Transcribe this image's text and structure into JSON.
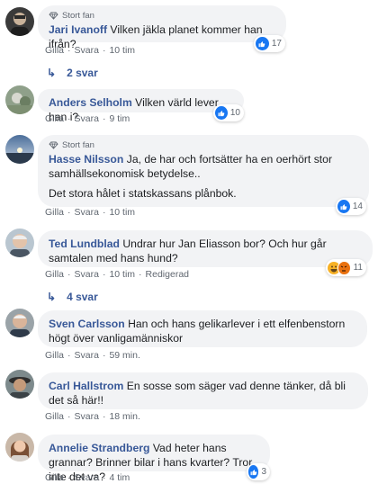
{
  "ui": {
    "like": "Gilla",
    "reply": "Svara",
    "sep": "·",
    "top_fan": "Stort fan",
    "reply_arrow": "↳"
  },
  "colors": {
    "link": "#385898",
    "bubble": "#f2f3f5",
    "like_blue": "#1877f2"
  },
  "comments": [
    {
      "name": "Jari Ivanoff",
      "text": "Vilken jäkla planet kommer han ifrån?",
      "time": "10 tim",
      "reactions": "17",
      "replies": "2 svar",
      "badge": true
    },
    {
      "name": "Anders Selholm",
      "text": "Vilken värld lever han i?",
      "time": "9 tim",
      "reactions": "10"
    },
    {
      "name": "Hasse Nilsson",
      "text": "Ja, de har och fortsätter ha en oerhört stor samhällsekonomisk betydelse..",
      "text2": "Det stora hålet i statskassans plånbok.",
      "time": "10 tim",
      "reactions": "14",
      "badge": true
    },
    {
      "name": "Ted Lundblad",
      "text": "Undrar hur Jan Eliasson bor? Och hur går samtalen med hans hund?",
      "time": "10 tim",
      "edited": "Redigerad",
      "reactions": "11",
      "replies": "4 svar"
    },
    {
      "name": "Sven Carlsson",
      "text": "Han och hans gelikarlever i ett elfenbenstorn högt över vanligamänniskor",
      "time": "59 min."
    },
    {
      "name": "Carl Hallstrom",
      "text": "En sosse som säger vad denne tänker, då bli det så här!!",
      "time": "18 min."
    },
    {
      "name": "Annelie Strandberg",
      "text": "Vad heter hans grannar? Brinner bilar i hans kvarter? Tror inte det va?",
      "time": "4 tim",
      "reactions": "3"
    }
  ]
}
